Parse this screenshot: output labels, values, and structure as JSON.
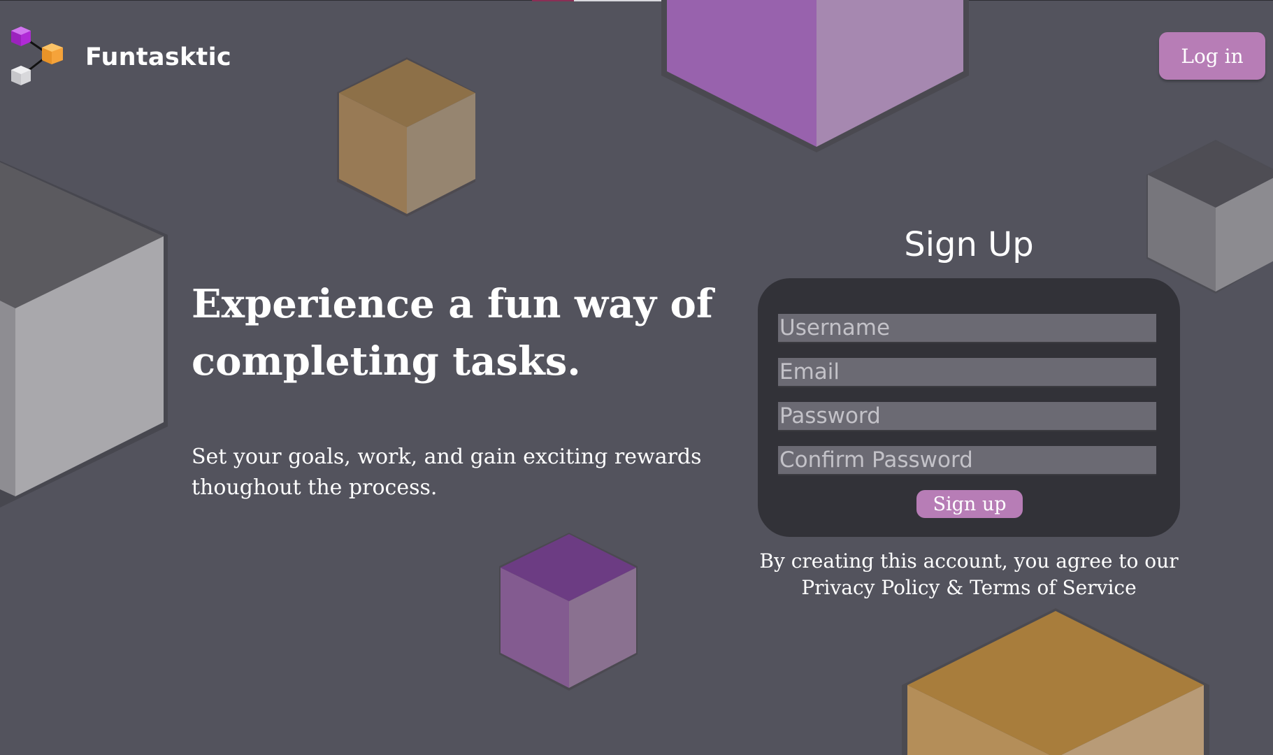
{
  "app": {
    "brand": "Funtasktic",
    "login_label": "Log in"
  },
  "hero": {
    "title": "Experience a fun way of completing tasks.",
    "subtitle": "Set your goals, work, and gain exciting rewards thoughout the process."
  },
  "signup": {
    "title": "Sign Up",
    "fields": [
      {
        "placeholder": "Username"
      },
      {
        "placeholder": "Email"
      },
      {
        "placeholder": "Password"
      },
      {
        "placeholder": "Confirm Password"
      }
    ],
    "button_label": "Sign up",
    "terms": "By creating this account, you agree to our Privacy Policy & Terms of Service"
  },
  "colors": {
    "background": "#53535d",
    "accent": "#b77db6",
    "card": "#323238"
  },
  "icons": [
    "logo-cubes-icon"
  ]
}
